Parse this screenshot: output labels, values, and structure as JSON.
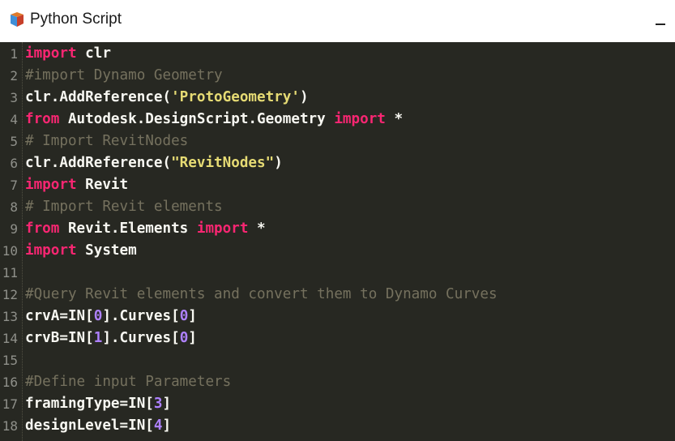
{
  "window": {
    "title": "Python Script",
    "icon": "python-script-node-icon",
    "minimize_label": "—"
  },
  "editor": {
    "colors": {
      "background": "#272822",
      "keyword": "#f92672",
      "comment": "#75715e",
      "string": "#e6db74",
      "number": "#ae81ff",
      "text": "#f8f8f2"
    },
    "lines": [
      {
        "n": "1",
        "tokens": [
          {
            "t": "kw",
            "s": "import"
          },
          {
            "t": "plain",
            "s": " clr"
          }
        ]
      },
      {
        "n": "2",
        "tokens": [
          {
            "t": "cm",
            "s": "#import Dynamo Geometry"
          }
        ]
      },
      {
        "n": "3",
        "tokens": [
          {
            "t": "plain",
            "s": "clr.AddReference("
          },
          {
            "t": "str",
            "s": "'ProtoGeometry'"
          },
          {
            "t": "plain",
            "s": ")"
          }
        ]
      },
      {
        "n": "4",
        "tokens": [
          {
            "t": "kw",
            "s": "from"
          },
          {
            "t": "plain",
            "s": " Autodesk.DesignScript.Geometry "
          },
          {
            "t": "kw",
            "s": "import"
          },
          {
            "t": "plain",
            "s": " *"
          }
        ]
      },
      {
        "n": "5",
        "tokens": [
          {
            "t": "cm",
            "s": "# Import RevitNodes"
          }
        ]
      },
      {
        "n": "6",
        "tokens": [
          {
            "t": "plain",
            "s": "clr.AddReference("
          },
          {
            "t": "str",
            "s": "\"RevitNodes\""
          },
          {
            "t": "plain",
            "s": ")"
          }
        ]
      },
      {
        "n": "7",
        "tokens": [
          {
            "t": "kw",
            "s": "import"
          },
          {
            "t": "plain",
            "s": " Revit"
          }
        ]
      },
      {
        "n": "8",
        "tokens": [
          {
            "t": "cm",
            "s": "# Import Revit elements"
          }
        ]
      },
      {
        "n": "9",
        "tokens": [
          {
            "t": "kw",
            "s": "from"
          },
          {
            "t": "plain",
            "s": " Revit.Elements "
          },
          {
            "t": "kw",
            "s": "import"
          },
          {
            "t": "plain",
            "s": " *"
          }
        ]
      },
      {
        "n": "10",
        "tokens": [
          {
            "t": "kw",
            "s": "import"
          },
          {
            "t": "plain",
            "s": " System"
          }
        ]
      },
      {
        "n": "11",
        "tokens": []
      },
      {
        "n": "12",
        "tokens": [
          {
            "t": "cm",
            "s": "#Query Revit elements and convert them to Dynamo Curves"
          }
        ]
      },
      {
        "n": "13",
        "tokens": [
          {
            "t": "plain",
            "s": "crvA=IN["
          },
          {
            "t": "num",
            "s": "0"
          },
          {
            "t": "plain",
            "s": "].Curves["
          },
          {
            "t": "num",
            "s": "0"
          },
          {
            "t": "plain",
            "s": "]"
          }
        ]
      },
      {
        "n": "14",
        "tokens": [
          {
            "t": "plain",
            "s": "crvB=IN["
          },
          {
            "t": "num",
            "s": "1"
          },
          {
            "t": "plain",
            "s": "].Curves["
          },
          {
            "t": "num",
            "s": "0"
          },
          {
            "t": "plain",
            "s": "]"
          }
        ]
      },
      {
        "n": "15",
        "tokens": []
      },
      {
        "n": "16",
        "tokens": [
          {
            "t": "cm",
            "s": "#Define input Parameters"
          }
        ]
      },
      {
        "n": "17",
        "tokens": [
          {
            "t": "plain",
            "s": "framingType=IN["
          },
          {
            "t": "num",
            "s": "3"
          },
          {
            "t": "plain",
            "s": "]"
          }
        ]
      },
      {
        "n": "18",
        "tokens": [
          {
            "t": "plain",
            "s": "designLevel=IN["
          },
          {
            "t": "num",
            "s": "4"
          },
          {
            "t": "plain",
            "s": "]"
          }
        ]
      }
    ]
  }
}
